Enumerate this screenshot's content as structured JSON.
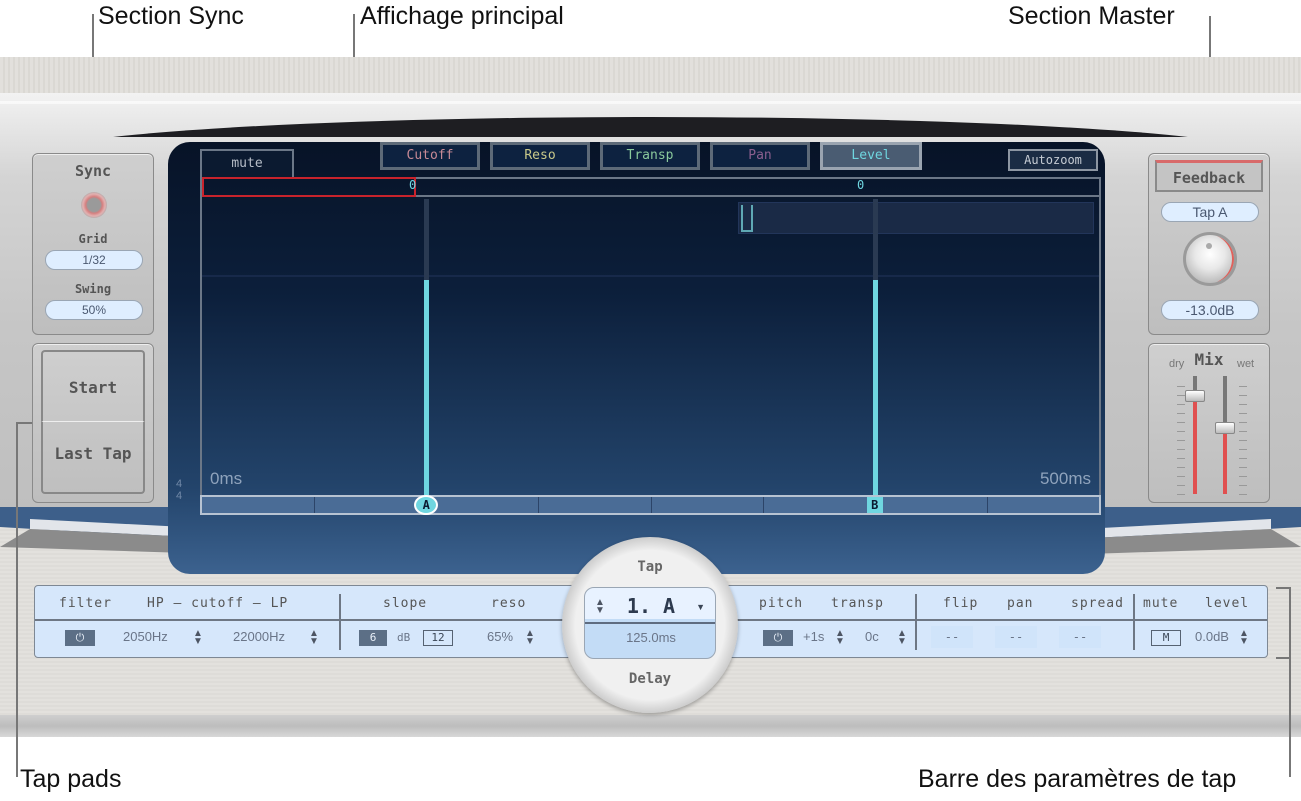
{
  "callouts": {
    "section_sync": "Section Sync",
    "main_display": "Affichage principal",
    "section_master": "Section Master",
    "tap_pads": "Tap pads",
    "tap_param_bar": "Barre des paramètres de tap"
  },
  "sync_section": {
    "title": "Sync",
    "grid_label": "Grid",
    "grid_value": "1/32",
    "swing_label": "Swing",
    "swing_value": "50%"
  },
  "tap_pads": {
    "start": "Start",
    "last_tap": "Last Tap"
  },
  "display": {
    "mute_tab": "mute",
    "view_buttons": [
      {
        "label": "Cutoff",
        "color": "#c88a96",
        "active": false
      },
      {
        "label": "Reso",
        "color": "#c9c98a",
        "active": false
      },
      {
        "label": "Transp",
        "color": "#8ac99c",
        "active": false
      },
      {
        "label": "Pan",
        "color": "#8a5f8e",
        "active": false
      },
      {
        "label": "Level",
        "color": "#6fd6e0",
        "active": true
      }
    ],
    "autozoom": "Autozoom",
    "time_start": "0ms",
    "time_end": "500ms",
    "time_signature_top": "4",
    "time_signature_bottom": "4",
    "taps": [
      {
        "name": "A",
        "time_ms": 125,
        "level": 0.72,
        "mute_value": "0"
      },
      {
        "name": "B",
        "time_ms": 375,
        "level": 0.72,
        "mute_value": "0"
      }
    ],
    "range_ms": 500,
    "accent_color": "#6fd6e0",
    "mute_color": "#c8232c"
  },
  "master_section": {
    "feedback_label": "Feedback",
    "feedback_tap": "Tap A",
    "feedback_value": "-13.0dB",
    "mix_label": "Mix",
    "dry_label": "dry",
    "wet_label": "wet",
    "dry_level": 0.85,
    "wet_level": 0.6
  },
  "tap_param_bar": {
    "headers": {
      "filter": "filter",
      "cutoff": "HP – cutoff – LP",
      "slope": "slope",
      "reso": "reso",
      "pitch": "pitch",
      "transp": "transp",
      "flip": "flip",
      "pan": "pan",
      "spread": "spread",
      "mute": "mute",
      "level": "level"
    },
    "values": {
      "filter_power": "⏻",
      "hp_cutoff": "2050Hz",
      "lp_cutoff": "22000Hz",
      "slope_6": "6",
      "slope_db": "dB",
      "slope_12": "12",
      "reso": "65%",
      "pitch_power": "⏻",
      "transp_semitones": "+1s",
      "transp_cents": "0c",
      "flip": "--",
      "pan": "--",
      "spread": "--",
      "mute": "M",
      "level": "0.0dB"
    },
    "tap_selector": {
      "title": "Tap",
      "current": "1. A",
      "delay_value": "125.0ms",
      "footer": "Delay"
    }
  }
}
